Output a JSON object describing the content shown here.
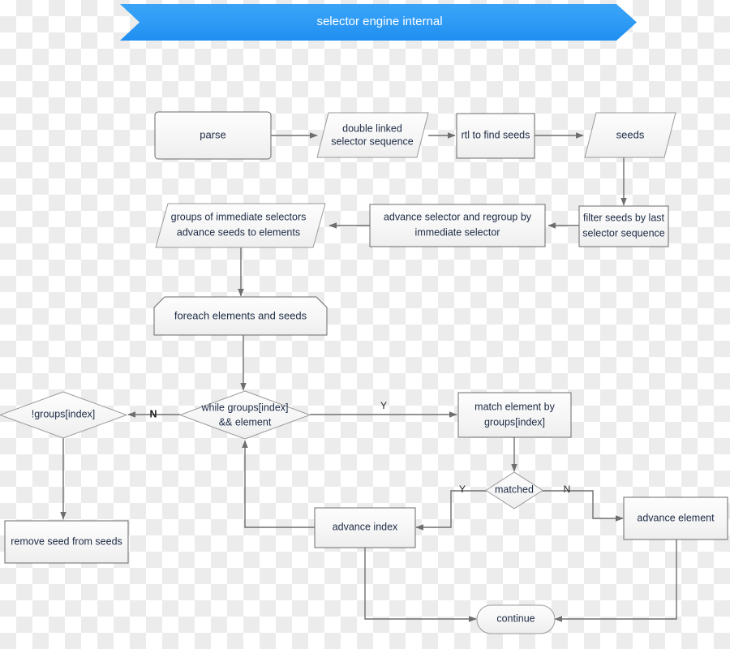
{
  "banner": {
    "title": "selector engine internal",
    "color": "#2f9bf5",
    "text_color": "#ffffff"
  },
  "diagram": {
    "line_color": "#6e6e6e",
    "node_stroke": "#6b6b6b",
    "node_text_color": "#1d2b44",
    "nodes": [
      {
        "id": "parse",
        "label": "parse",
        "shape": "rounded-rect"
      },
      {
        "id": "double_linked",
        "label_line1": "double linked",
        "label_line2": "selector sequence",
        "shape": "parallelogram"
      },
      {
        "id": "rtl_find_seeds",
        "label": "rtl to find seeds",
        "shape": "rect"
      },
      {
        "id": "seeds",
        "label": "seeds",
        "shape": "parallelogram"
      },
      {
        "id": "filter_seeds",
        "label_line1": "filter seeds by last",
        "label_line2": "selector sequence",
        "shape": "rect"
      },
      {
        "id": "advance_regroup",
        "label_line1": "advance selector and regroup by",
        "label_line2": "immediate selector",
        "shape": "rect"
      },
      {
        "id": "groups_immediate",
        "label_line1": "groups of immediate selectors",
        "label_line2": "advance seeds to elements",
        "shape": "parallelogram"
      },
      {
        "id": "foreach",
        "label": "foreach elements and seeds",
        "shape": "loop-limit"
      },
      {
        "id": "while_groups",
        "label_line1": "while groups[index]",
        "label_line2": "&& element",
        "shape": "diamond"
      },
      {
        "id": "not_groups",
        "label": "!groups[index]",
        "shape": "diamond"
      },
      {
        "id": "match_element",
        "label_line1": "match element by",
        "label_line2": "groups[index]",
        "shape": "rect"
      },
      {
        "id": "matched",
        "label": "matched",
        "shape": "diamond"
      },
      {
        "id": "remove_seed",
        "label": "remove seed from seeds",
        "shape": "rect"
      },
      {
        "id": "advance_index",
        "label": "advance index",
        "shape": "rect"
      },
      {
        "id": "advance_element",
        "label": "advance element",
        "shape": "rect"
      },
      {
        "id": "continue",
        "label": "continue",
        "shape": "stadium"
      }
    ],
    "edge_labels": {
      "while_to_not_groups": "N",
      "while_to_match": "Y",
      "matched_yes": "Y",
      "matched_no": "N"
    }
  }
}
